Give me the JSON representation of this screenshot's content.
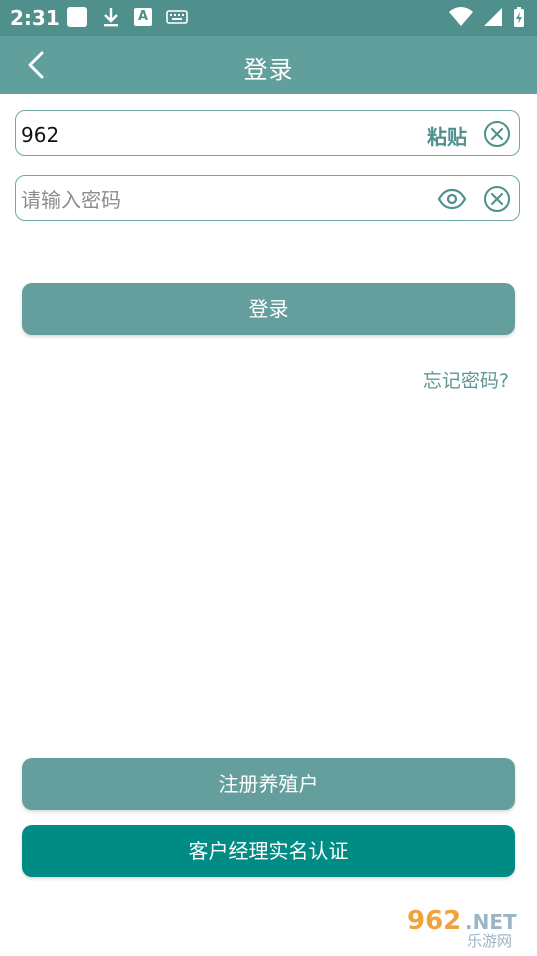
{
  "status_bar": {
    "time": "2:31",
    "icons": [
      "square-notification-icon",
      "download-icon",
      "font-a-icon",
      "keyboard-icon",
      "wifi-icon",
      "signal-icon",
      "battery-charging-icon"
    ],
    "notif_letter": "A"
  },
  "header": {
    "title": "登录",
    "back_icon": "chevron-left-icon"
  },
  "login_form": {
    "account_value": "962",
    "paste_label": "粘贴",
    "password_placeholder": "请输入密码",
    "eye_icon": "eye-icon",
    "clear_icon": "clear-circle-icon"
  },
  "actions": {
    "login_label": "登录",
    "forgot_label": "忘记密码?",
    "register_label": "注册养殖户",
    "manager_label": "客户经理实名认证"
  },
  "watermark": {
    "number": "962",
    "domain": ".NET",
    "name": "乐游网"
  },
  "colors": {
    "status_bar": "#4f8f8c",
    "app_bar": "#619f9d",
    "button_light": "#649f9d",
    "button_dark": "#008c85",
    "link": "#5c9896"
  }
}
